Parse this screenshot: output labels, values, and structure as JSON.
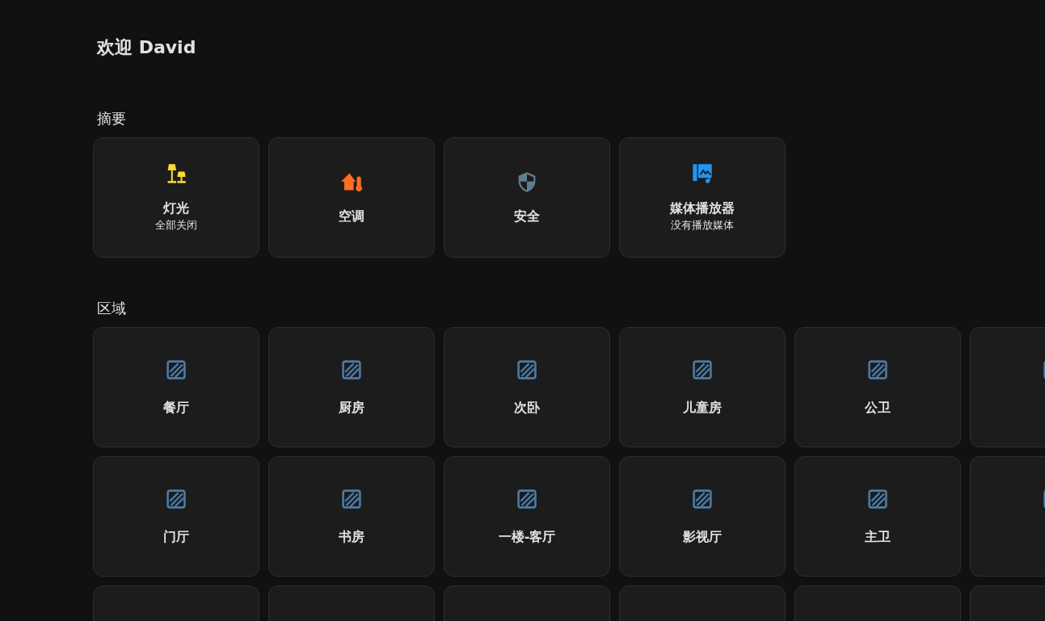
{
  "greeting": "欢迎 David",
  "summary": {
    "heading": "摘要",
    "cards": [
      {
        "kind": "lights",
        "name": "灯光",
        "subtitle": "全部关闭",
        "color": "#fdd835"
      },
      {
        "kind": "climate",
        "name": "空调",
        "color": "#ff6f22"
      },
      {
        "kind": "security",
        "name": "安全",
        "color": "#5f7d8c"
      },
      {
        "kind": "media",
        "name": "媒体播放器",
        "subtitle": "没有播放媒体",
        "color": "#2196f3"
      }
    ]
  },
  "areas": {
    "heading": "区域",
    "cards": [
      {
        "kind": "full",
        "name": "餐厅"
      },
      {
        "kind": "full",
        "name": "厨房"
      },
      {
        "kind": "full",
        "name": "次卧"
      },
      {
        "kind": "full",
        "name": "儿童房"
      },
      {
        "kind": "full",
        "name": "公卫"
      },
      {
        "kind": "icon_only"
      },
      {
        "kind": "full",
        "name": "门厅"
      },
      {
        "kind": "full",
        "name": "书房"
      },
      {
        "kind": "full",
        "name": "一楼-客厅"
      },
      {
        "kind": "full",
        "name": "影视厅"
      },
      {
        "kind": "full",
        "name": "主卫"
      },
      {
        "kind": "icon_only"
      },
      {
        "kind": "edge"
      },
      {
        "kind": "edge"
      },
      {
        "kind": "edge"
      },
      {
        "kind": "edge"
      },
      {
        "kind": "edge"
      },
      {
        "kind": "edge"
      }
    ]
  }
}
